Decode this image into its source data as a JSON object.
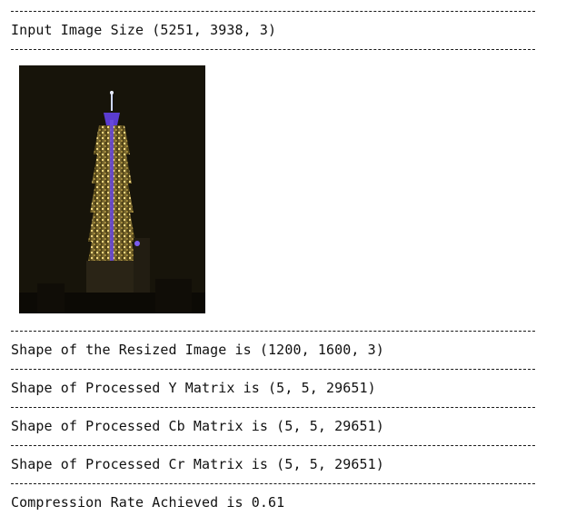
{
  "output": {
    "input_size_text": "Input Image Size (5251, 3938, 3)",
    "resized_text": "Shape of the Resized Image is (1200, 1600, 3)",
    "y_matrix_text": "Shape of Processed Y Matrix is (5, 5, 29651)",
    "cb_matrix_text": "Shape of Processed Cb Matrix is (5, 5, 29651)",
    "cr_matrix_text": "Shape of Processed Cr Matrix is (5, 5, 29651)",
    "compression_text": "Compression Rate Achieved is 0.61"
  },
  "image": {
    "subject": "illuminated skyscraper at night",
    "colors": {
      "background": "#1a160a",
      "lights": "#d8b84a",
      "accent": "#5a3cd0"
    }
  }
}
